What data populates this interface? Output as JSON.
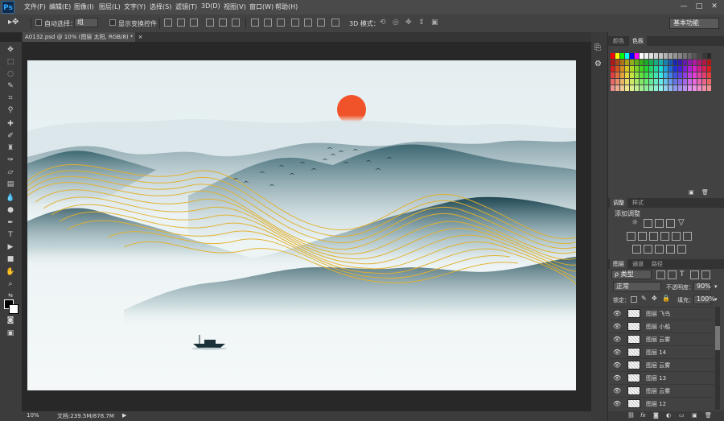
{
  "app": {
    "logo": "Ps"
  },
  "menu": {
    "items": [
      "文件(F)",
      "编辑(E)",
      "图像(I)",
      "图层(L)",
      "文字(Y)",
      "选择(S)",
      "滤镜(T)",
      "3D(D)",
      "视图(V)",
      "窗口(W)",
      "帮助(H)"
    ]
  },
  "window_controls": {
    "minimize": "—",
    "maximize": "□",
    "close": "✕"
  },
  "options": {
    "auto_select_label": "自动选择：",
    "auto_select_value": "组",
    "show_transform_label": "显示变换控件",
    "mode_3d_label": "3D 模式：",
    "workspace": "基本功能"
  },
  "document": {
    "tab_title": "A0132.psd @ 10% (图层 太阳, RGB/8) *",
    "tab_close": "×"
  },
  "status": {
    "zoom": "10%",
    "doc_info": "文档:239.5M/878.7M"
  },
  "panels": {
    "color_tabs": [
      "颜色",
      "色板"
    ],
    "adjust_tabs": [
      "调整",
      "样式"
    ],
    "adjust_title": "添加调整",
    "layers_tabs": [
      "图层",
      "通道",
      "路径"
    ],
    "filter_kind": "ρ 类型",
    "blend_mode": "正常",
    "opacity_label": "不透明度：",
    "opacity_value": "90%",
    "lock_label": "锁定：",
    "fill_label": "填充：",
    "fill_value": "100%",
    "layers": [
      "图层 飞鸟",
      "图层 小船",
      "图层 云雾",
      "图层 14",
      "图层 云雾",
      "图层 13",
      "图层 云雾",
      "图层 12"
    ]
  },
  "colors": {
    "menubar": "#4a4a4a",
    "panel": "#424242",
    "sun": "#f0522a",
    "gold": "#e2b12b",
    "mountain": "#2b5563"
  }
}
